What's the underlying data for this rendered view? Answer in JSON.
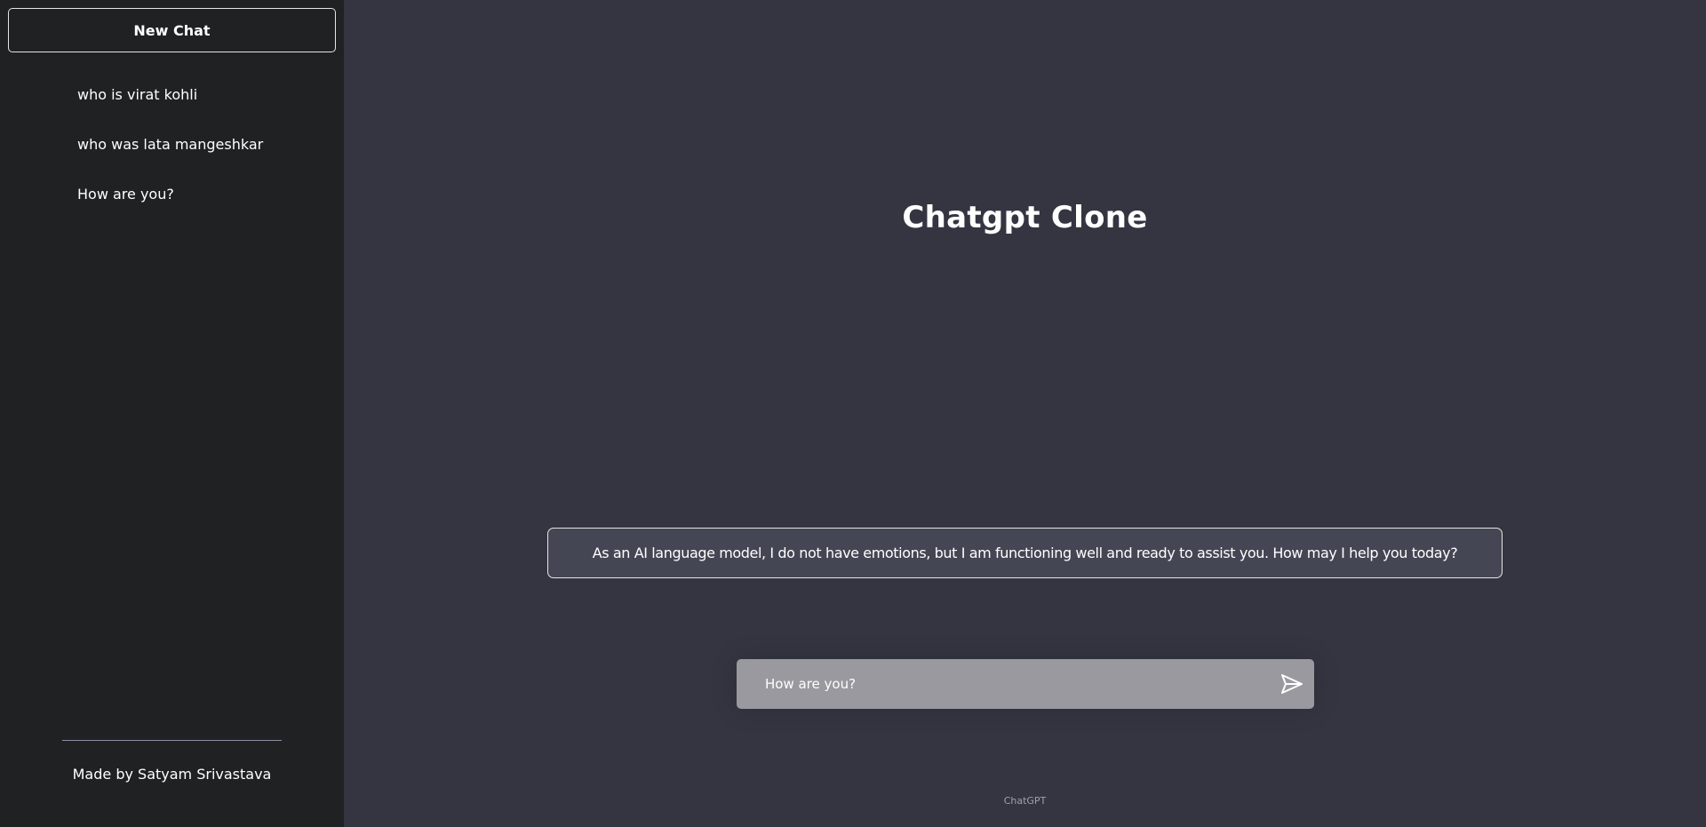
{
  "sidebar": {
    "new_chat_label": "New Chat",
    "history": [
      {
        "label": "who is virat kohli"
      },
      {
        "label": "who was lata mangeshkar"
      },
      {
        "label": "How are you?"
      }
    ],
    "made_by": "Made by Satyam Srivastava"
  },
  "main": {
    "title": "Chatgpt Clone",
    "response": "As an AI language model, I do not have emotions, but I am functioning well and ready to assist you. How may I help you today?",
    "input": {
      "value": "How are you?",
      "placeholder": ""
    },
    "send_icon": "send-icon",
    "footer": "ChatGPT"
  },
  "colors": {
    "sidebar_bg": "#202123",
    "main_bg": "#343541",
    "response_bg": "#444654",
    "input_bg": "#9a999f",
    "text": "#ffffff"
  }
}
